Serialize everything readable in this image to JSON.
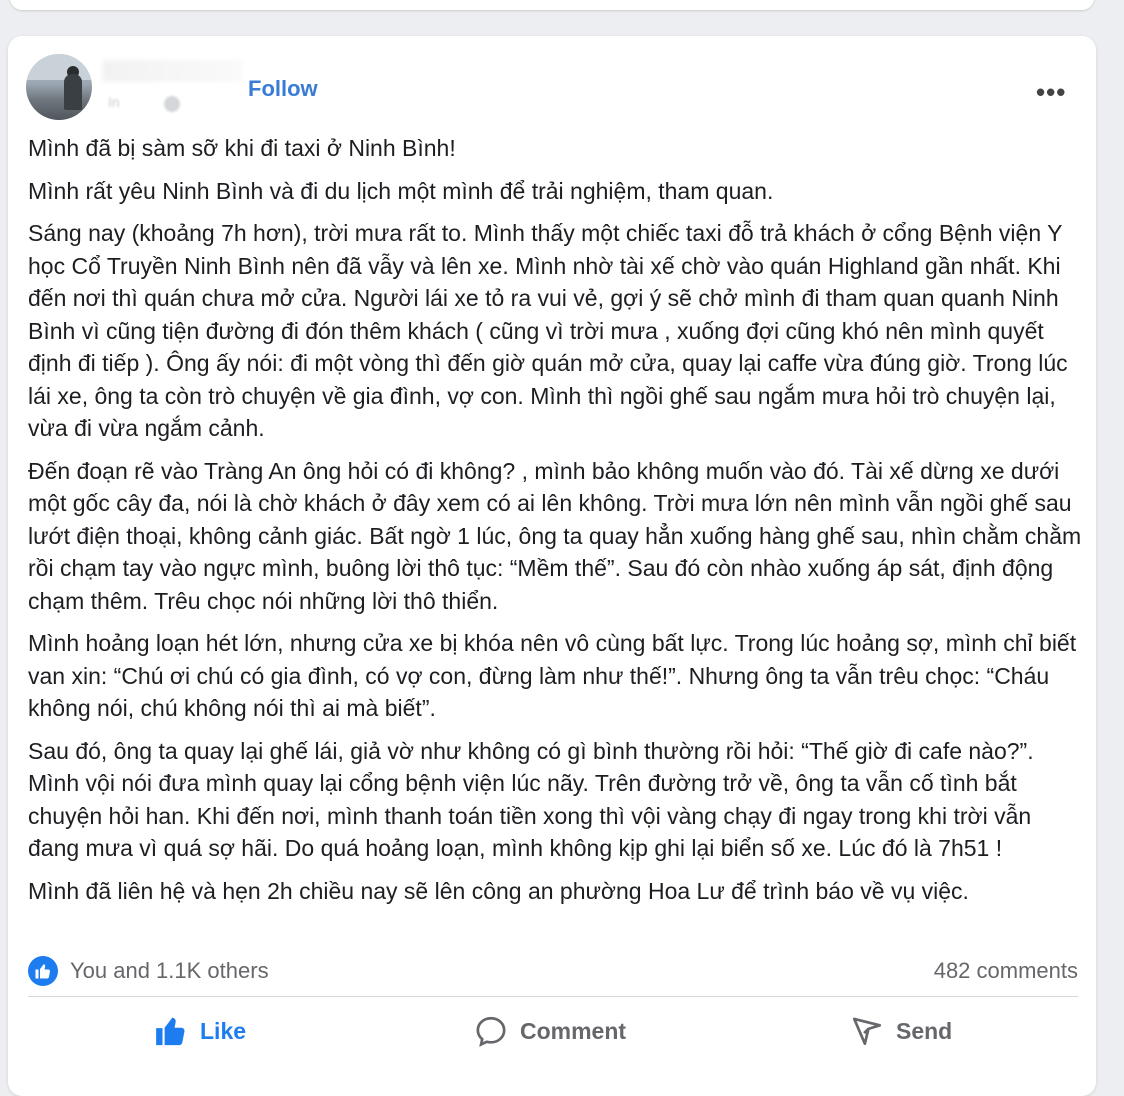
{
  "header": {
    "follow_label": "Follow",
    "meta_text": "In"
  },
  "post": {
    "paragraphs": [
      "Mình đã bị sàm sỡ khi đi taxi ở Ninh Bình!",
      "Mình rất yêu Ninh Bình và đi du lịch một mình để trải nghiệm, tham quan.",
      "Sáng nay (khoảng 7h hơn), trời mưa rất to. Mình thấy một chiếc taxi đỗ trả khách ở cổng Bệnh viện Y học Cổ Truyền Ninh Bình nên đã vẫy và lên xe. Mình nhờ tài xế chờ vào quán Highland gần nhất. Khi đến nơi thì quán chưa mở cửa. Người lái xe tỏ ra vui vẻ, gợi ý sẽ chở mình đi tham quan quanh Ninh Bình vì cũng tiện đường đi đón thêm khách ( cũng vì trời mưa , xuống đợi cũng khó nên mình quyết định đi tiếp ). Ông ấy nói: đi một vòng thì đến giờ quán mở cửa, quay lại caffe vừa đúng giờ. Trong lúc lái xe, ông ta còn trò chuyện về gia đình, vợ con. Mình thì ngồi ghế sau ngắm mưa hỏi trò chuyện lại, vừa đi vừa ngắm cảnh.",
      "Đến đoạn rẽ vào Tràng An ông hỏi có đi không? , mình bảo không muốn vào đó. Tài xế dừng xe dưới một gốc cây đa, nói là chờ khách ở đây xem có ai lên không. Trời mưa lớn nên mình vẫn ngồi ghế sau lướt điện thoại, không cảnh giác. Bất ngờ 1 lúc, ông ta quay hẳn xuống hàng ghế sau, nhìn chằm chằm rồi chạm tay vào ngực mình, buông lời thô tục: “Mềm thế”. Sau đó còn nhào xuống áp sát, định động chạm thêm. Trêu chọc nói những lời thô thiển.",
      "Mình hoảng loạn hét lớn, nhưng cửa xe bị khóa nên vô cùng bất lực. Trong lúc hoảng sợ, mình chỉ biết van xin: “Chú ơi chú có gia đình, có vợ con, đừng làm như thế!”. Nhưng ông ta vẫn trêu chọc: “Cháu không nói, chú không nói thì ai mà biết”.",
      "Sau đó, ông ta quay lại ghế lái, giả vờ như không có gì bình thường rồi hỏi: “Thế giờ đi cafe nào?”. Mình vội nói đưa mình quay lại cổng bệnh viện lúc nãy. Trên đường trở về, ông ta vẫn cố tình bắt chuyện hỏi han. Khi đến nơi, mình thanh toán tiền xong thì vội vàng chạy đi ngay trong khi trời vẫn đang mưa vì quá sợ hãi. Do quá hoảng loạn, mình không kịp ghi lại biển số xe. Lúc đó là 7h51 !",
      "Mình đã liên hệ và hẹn 2h chiều nay sẽ lên công an phường Hoa Lư để trình báo về vụ việc."
    ]
  },
  "stats": {
    "reactions_text": "You and 1.1K others",
    "comments_text": "482 comments"
  },
  "actions": {
    "like_label": "Like",
    "comment_label": "Comment",
    "send_label": "Send"
  },
  "colors": {
    "accent": "#1d7df0",
    "follow": "#3a7bd5",
    "muted": "#65676b"
  },
  "icons": [
    "more-options-icon",
    "like-badge-icon",
    "thumbs-up-icon",
    "comment-bubble-icon",
    "send-icon"
  ]
}
